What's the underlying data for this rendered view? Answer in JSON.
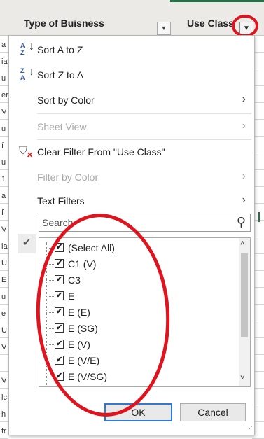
{
  "header": {
    "col1_title": "Type of Buisness",
    "col2_title": "Use Class",
    "dropdown_icon": "dropdown-arrow-icon",
    "filter_icon": "filter-active-icon"
  },
  "left_chars": [
    "a",
    "ia",
    "u",
    "er",
    "V",
    "u",
    "í",
    "u",
    "1",
    "a",
    "f",
    "V",
    "la",
    "U",
    "E",
    "u",
    "e",
    "U",
    "V",
    "",
    "V",
    "lc",
    "h",
    "fr"
  ],
  "menu": {
    "sort_az": "Sort A to Z",
    "sort_za": "Sort Z to A",
    "sort_by_color": "Sort by Color",
    "sheet_view": "Sheet View",
    "clear_filter": "Clear Filter From \"Use Class\"",
    "filter_by_color": "Filter by Color",
    "text_filters": "Text Filters",
    "search_placeholder": "Search",
    "items": [
      {
        "label": "(Select All)",
        "checked": true
      },
      {
        "label": "C1 (V)",
        "checked": true
      },
      {
        "label": "C3",
        "checked": true
      },
      {
        "label": "E",
        "checked": true
      },
      {
        "label": "E (E)",
        "checked": true
      },
      {
        "label": "E (SG)",
        "checked": true
      },
      {
        "label": "E (V)",
        "checked": true
      },
      {
        "label": "E (V/E)",
        "checked": true
      },
      {
        "label": "E (V/SG)",
        "checked": true
      }
    ],
    "ok": "OK",
    "cancel": "Cancel"
  },
  "colors": {
    "annotation": "#e0141e",
    "excel_green": "#217346",
    "ok_border": "#2b7bd6"
  }
}
